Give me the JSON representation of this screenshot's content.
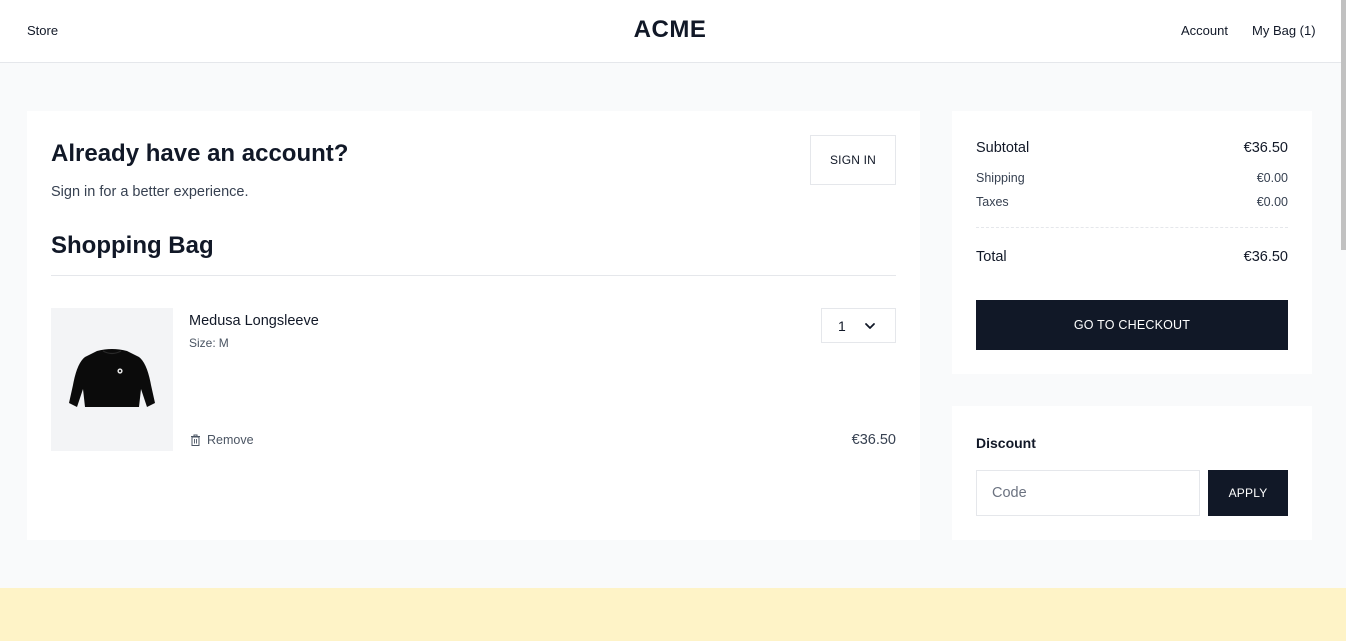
{
  "header": {
    "store_label": "Store",
    "brand": "ACME",
    "account_label": "Account",
    "bag_label": "My Bag (1)"
  },
  "signin": {
    "title": "Already have an account?",
    "subtitle": "Sign in for a better experience.",
    "button_label": "SIGN IN"
  },
  "bag": {
    "title": "Shopping Bag",
    "items": [
      {
        "name": "Medusa Longsleeve",
        "size_label": "Size:",
        "size_value": "M",
        "quantity": "1",
        "remove_label": "Remove",
        "price": "€36.50",
        "image_icon": "black-longsleeve-shirt"
      }
    ]
  },
  "summary": {
    "subtotal_label": "Subtotal",
    "subtotal_value": "€36.50",
    "shipping_label": "Shipping",
    "shipping_value": "€0.00",
    "taxes_label": "Taxes",
    "taxes_value": "€0.00",
    "total_label": "Total",
    "total_value": "€36.50",
    "checkout_label": "GO TO CHECKOUT"
  },
  "discount": {
    "title": "Discount",
    "placeholder": "Code",
    "apply_label": "APPLY"
  },
  "colors": {
    "primary_button": "#111827",
    "page_background": "#f9fafb",
    "footer_band": "#fef3c7"
  }
}
